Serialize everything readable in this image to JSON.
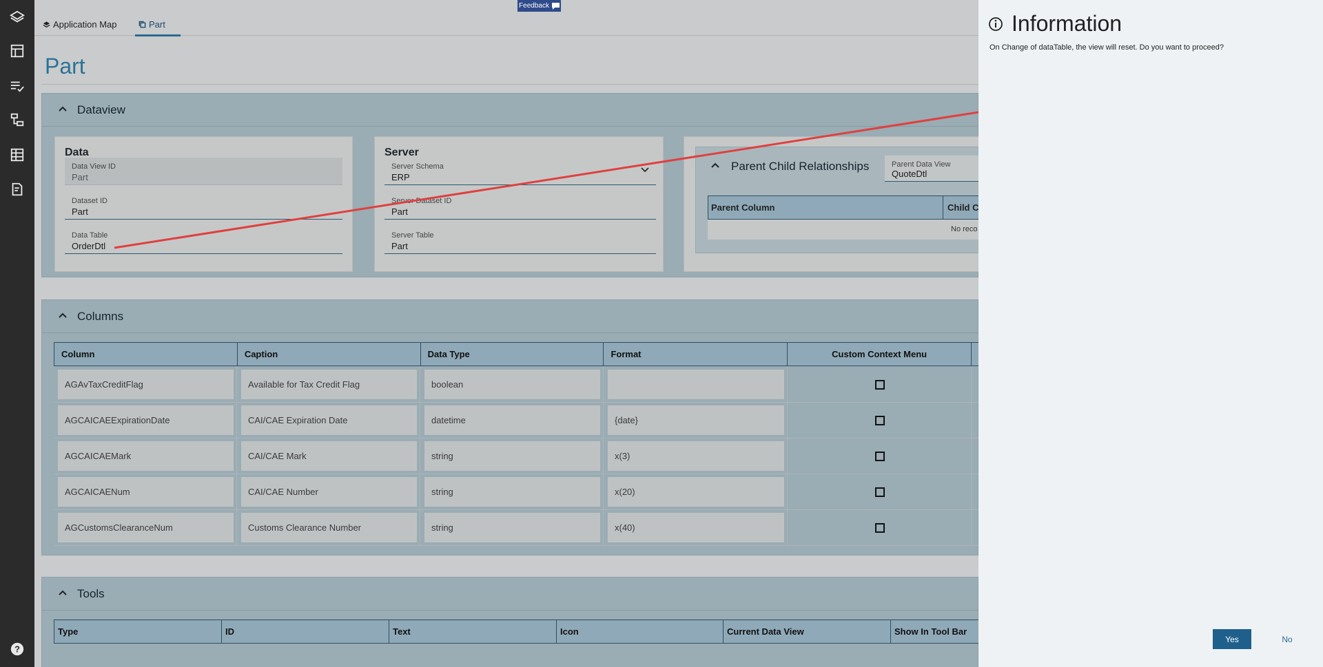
{
  "feedback": {
    "label": "Feedback"
  },
  "tabs": [
    {
      "label": "Application Map"
    },
    {
      "label": "Part"
    }
  ],
  "page": {
    "title": "Part"
  },
  "dataview": {
    "title": "Dataview",
    "data_card": {
      "title": "Data",
      "fields": [
        {
          "label": "Data View ID",
          "value": "Part"
        },
        {
          "label": "Dataset ID",
          "value": "Part"
        },
        {
          "label": "Data Table",
          "value": "OrderDtl"
        }
      ]
    },
    "server_card": {
      "title": "Server",
      "fields": [
        {
          "label": "Server Schema",
          "value": "ERP"
        },
        {
          "label": "Server Dataset ID",
          "value": "Part"
        },
        {
          "label": "Server Table",
          "value": "Part"
        }
      ]
    },
    "relationships": {
      "title": "Parent Child Relationships",
      "parent_data_view_label": "Parent Data View",
      "parent_data_view_value": "QuoteDtl",
      "columns": [
        "Parent Column",
        "Child Co"
      ],
      "empty_text": "No reco"
    }
  },
  "columns_section": {
    "title": "Columns",
    "headers": [
      "Column",
      "Caption",
      "Data Type",
      "Format",
      "Custom Context Menu"
    ],
    "rows": [
      {
        "column": "AGAvTaxCreditFlag",
        "caption": "Available for Tax Credit Flag",
        "type": "boolean",
        "format": ""
      },
      {
        "column": "AGCAICAEExpirationDate",
        "caption": "CAI/CAE Expiration Date",
        "type": "datetime",
        "format": "{date}"
      },
      {
        "column": "AGCAICAEMark",
        "caption": "CAI/CAE Mark",
        "type": "string",
        "format": "x(3)"
      },
      {
        "column": "AGCAICAENum",
        "caption": "CAI/CAE Number",
        "type": "string",
        "format": "x(20)"
      },
      {
        "column": "AGCustomsClearanceNum",
        "caption": "Customs Clearance Number",
        "type": "string",
        "format": "x(40)"
      }
    ]
  },
  "tools_section": {
    "title": "Tools",
    "headers": [
      "Type",
      "ID",
      "Text",
      "Icon",
      "Current Data View",
      "Show In Tool Bar"
    ]
  },
  "dialog": {
    "title": "Information",
    "message": "On Change of dataTable, the view will reset. Do you want to proceed?",
    "yes_label": "Yes",
    "no_label": "No"
  },
  "colors": {
    "rail": "#2b2b2b",
    "accent": "#2a7396",
    "primary_button": "#1f5f8b",
    "annotation_arrow": "#e0403e",
    "drawer_bg": "#eef2f5"
  }
}
